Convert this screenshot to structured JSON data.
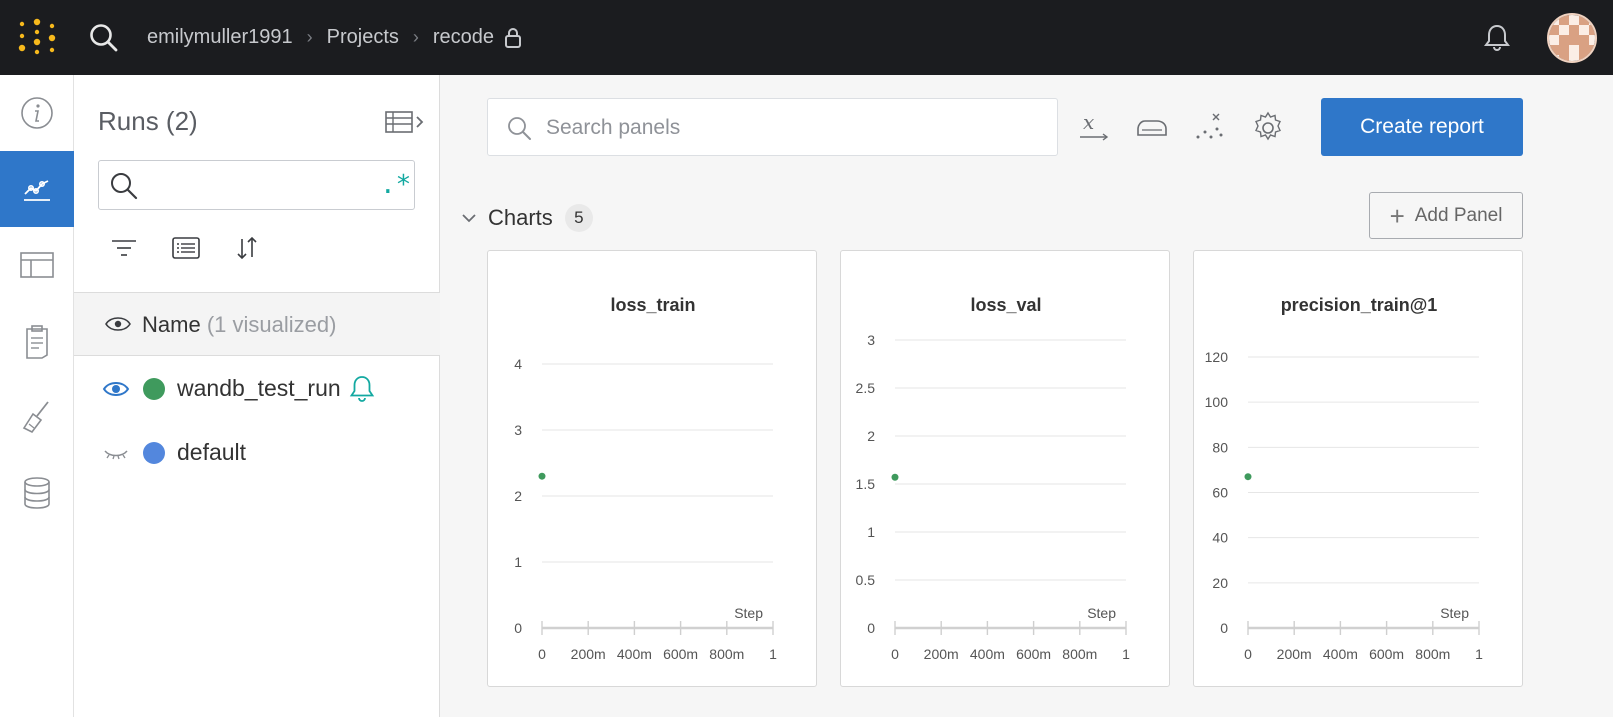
{
  "topbar": {
    "icons": {
      "logo": "wandb-logo-icon",
      "search": "search-icon",
      "notifications": "bell-icon",
      "avatar": "user-avatar"
    },
    "breadcrumbs": [
      "emilymuller1991",
      "Projects",
      "recode"
    ],
    "lock_icon": "lock-icon"
  },
  "rail": {
    "items": [
      {
        "icon": "info-icon",
        "active": false
      },
      {
        "icon": "workspace-chart-icon",
        "active": true
      },
      {
        "icon": "table-icon",
        "active": false
      },
      {
        "icon": "report-clipboard-icon",
        "active": false
      },
      {
        "icon": "sweep-broom-icon",
        "active": false
      },
      {
        "icon": "artifacts-database-icon",
        "active": false
      }
    ],
    "accent": "#2f77c9"
  },
  "runs": {
    "title": "Runs (2)",
    "search_value": "",
    "regex_label": ".*",
    "toolbar_icons": [
      "filter-icon",
      "group-icon",
      "sort-icon"
    ],
    "header": {
      "name": "Name",
      "visualized": "(1 visualized)"
    },
    "rows": [
      {
        "name": "wandb_test_run",
        "visible": true,
        "color": "#3f9a5d",
        "alert": true
      },
      {
        "name": "default",
        "visible": false,
        "color": "#5387dd",
        "alert": false
      }
    ]
  },
  "main": {
    "search_placeholder": "Search panels",
    "header_icons": [
      "x-axis-icon",
      "smoothing-iron-icon",
      "outliers-icon",
      "settings-gear-icon"
    ],
    "create_report_label": "Create report",
    "section": {
      "title": "Charts",
      "count": "5"
    },
    "add_panel_label": "Add Panel"
  },
  "chart_data": [
    {
      "type": "scatter",
      "title": "loss_train",
      "xlabel": "Step",
      "x_ticks": [
        "0",
        "200m",
        "400m",
        "600m",
        "800m",
        "1"
      ],
      "y_ticks": [
        "0",
        "1",
        "2",
        "3",
        "4"
      ],
      "xlim": [
        0,
        1
      ],
      "ylim": [
        0,
        4
      ],
      "series": [
        {
          "name": "wandb_test_run",
          "color": "#3f9a5d",
          "points": [
            {
              "x": 0,
              "y": 2.3
            }
          ]
        }
      ]
    },
    {
      "type": "scatter",
      "title": "loss_val",
      "xlabel": "Step",
      "x_ticks": [
        "0",
        "200m",
        "400m",
        "600m",
        "800m",
        "1"
      ],
      "y_ticks": [
        "0",
        "0.5",
        "1",
        "1.5",
        "2",
        "2.5",
        "3"
      ],
      "xlim": [
        0,
        1
      ],
      "ylim": [
        0,
        3
      ],
      "series": [
        {
          "name": "wandb_test_run",
          "color": "#3f9a5d",
          "points": [
            {
              "x": 0,
              "y": 1.57
            }
          ]
        }
      ]
    },
    {
      "type": "scatter",
      "title": "precision_train@1",
      "xlabel": "Step",
      "x_ticks": [
        "0",
        "200m",
        "400m",
        "600m",
        "800m",
        "1"
      ],
      "y_ticks": [
        "0",
        "20",
        "40",
        "60",
        "80",
        "100",
        "120"
      ],
      "xlim": [
        0,
        1
      ],
      "ylim": [
        0,
        120
      ],
      "series": [
        {
          "name": "wandb_test_run",
          "color": "#3f9a5d",
          "points": [
            {
              "x": 0,
              "y": 67
            }
          ]
        }
      ]
    }
  ]
}
